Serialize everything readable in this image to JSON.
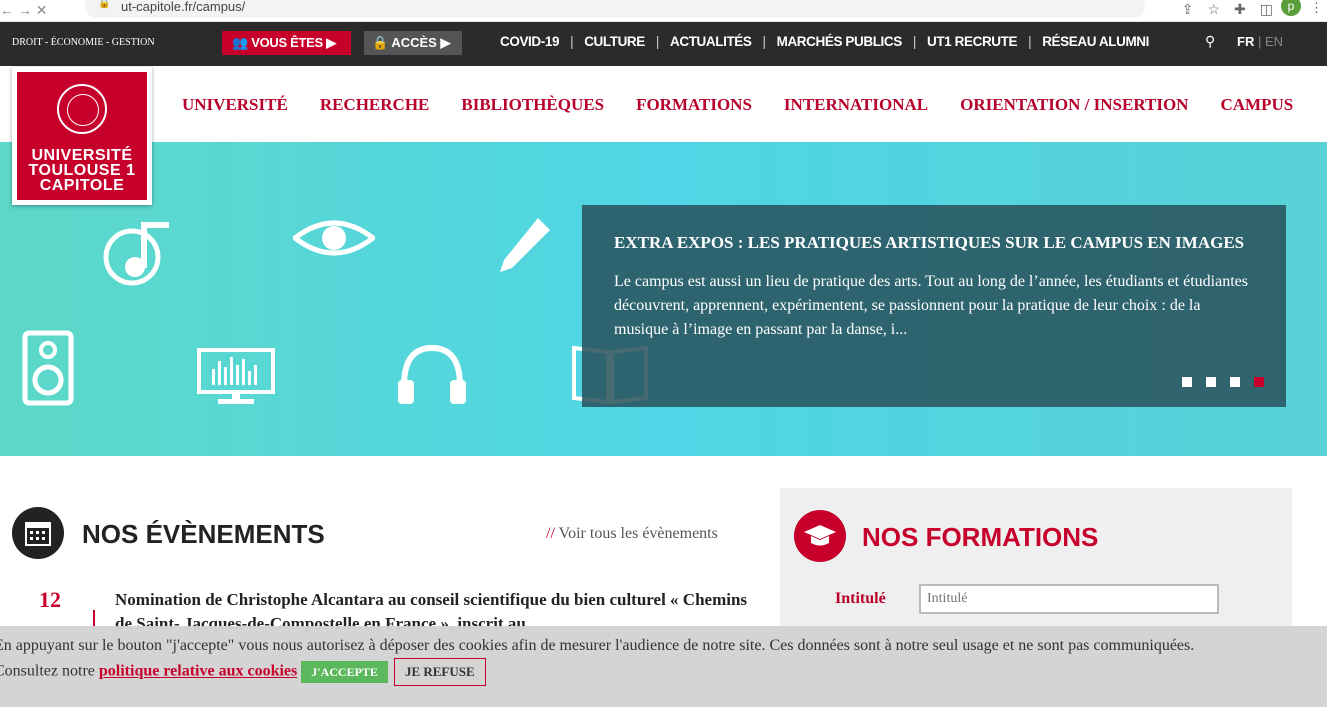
{
  "browser": {
    "url": "ut-capitole.fr/campus/",
    "avatar": "p",
    "nav_icons": "← → ✕",
    "tool_icons": "⇪☆✚◫",
    "menu_icon": "⋮"
  },
  "topbar": {
    "tagline": "DROIT - ÉCONOMIE - GESTION",
    "vous_etes": "VOUS ÊTES",
    "acces": "ACCÈS",
    "links": [
      "COVID-19",
      "CULTURE",
      "ACTUALITÉS",
      "MARCHÉS PUBLICS",
      "UT1 RECRUTE",
      "RÉSEAU ALUMNI"
    ],
    "lang_fr": "FR",
    "lang_sep": " | ",
    "lang_en": "EN"
  },
  "logo": {
    "line1": "UNIVERSITÉ",
    "line2": "TOULOUSE 1",
    "line3": "CAPITOLE"
  },
  "mainnav": [
    "UNIVERSITÉ",
    "RECHERCHE",
    "BIBLIOTHÈQUES",
    "FORMATIONS",
    "INTERNATIONAL",
    "ORIENTATION / INSERTION",
    "CAMPUS"
  ],
  "hero": {
    "title": "EXTRA EXPOS : LES PRATIQUES ARTISTIQUES SUR LE CAMPUS EN IMAGES",
    "text": "Le campus est aussi un lieu de pratique des arts. Tout au long de l’année, les étudiants et étudiantes découvrent, apprennent, expérimentent, se passionnent pour la pratique de leur choix : de la musique à l’image en passant par la danse, i...",
    "slide_count": 4,
    "active_slide": 4
  },
  "events": {
    "title": "NOS ÉVÈNEMENTS",
    "link_prefix": "//",
    "link": "Voir tous les évènements",
    "day": "12",
    "item": "Nomination de Christophe Alcantara au conseil scientifique du bien culturel « Chemins de Saint- Jacques-de-Compostelle en France », inscrit au"
  },
  "formations": {
    "title": "NOS FORMATIONS",
    "label": "Intitulé",
    "placeholder": "Intitulé"
  },
  "cookie": {
    "text1": "En appuyant sur le bouton \"j'accepte\" vous nous autorisez à déposer des cookies afin de mesurer l'audience de notre site. Ces données sont à notre seul usage et ne sont pas communiquées.",
    "text2": "Consultez notre",
    "policy": "politique relative aux cookies",
    "accept": "J'ACCEPTE",
    "refuse": "JE REFUSE"
  }
}
